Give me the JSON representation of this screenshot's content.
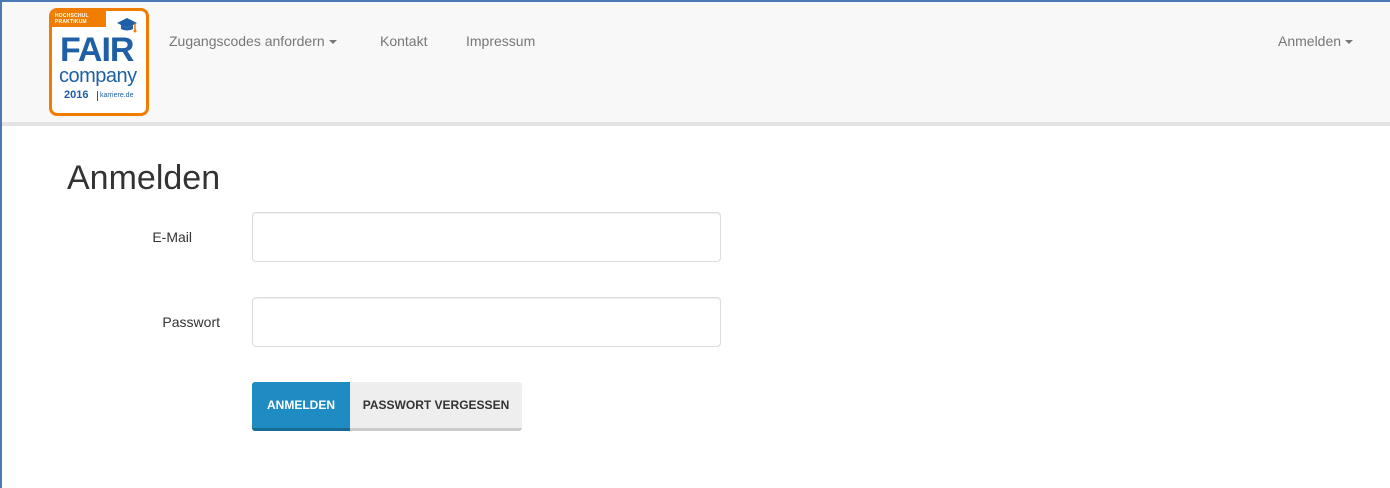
{
  "logo": {
    "ribbon_line1": "HOCHSCHUL",
    "ribbon_line2": "PRAKTIKUM",
    "word1": "FAIR",
    "word2": "company",
    "year": "2016",
    "site": "karriere.de",
    "brand_color": "#1e5fa6",
    "accent_color": "#f07d00"
  },
  "navbar": {
    "items": [
      {
        "label": "Zugangscodes anfordern",
        "dropdown": true
      },
      {
        "label": "Kontakt",
        "dropdown": false
      },
      {
        "label": "Impressum",
        "dropdown": false
      }
    ],
    "right_item": {
      "label": "Anmelden",
      "dropdown": true
    }
  },
  "page": {
    "title": "Anmelden"
  },
  "form": {
    "email_label": "E-Mail",
    "email_value": "",
    "password_label": "Passwort",
    "password_value": "",
    "submit_label": "ANMELDEN",
    "forgot_label": "PASSWORT VERGESSEN",
    "primary_color": "#1e8bc3"
  }
}
